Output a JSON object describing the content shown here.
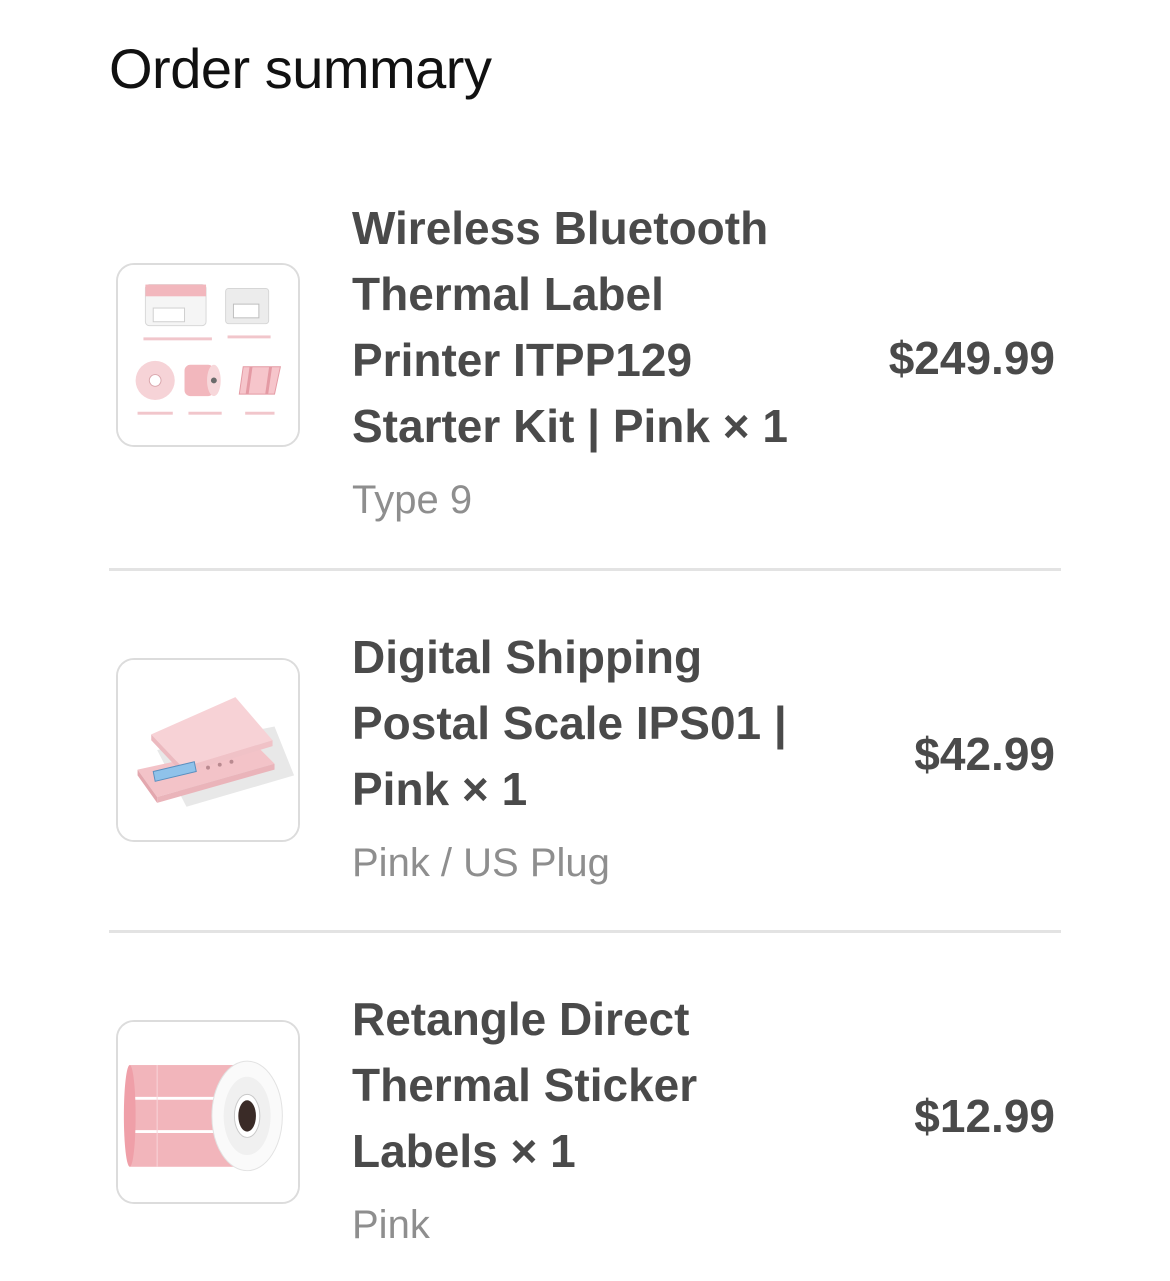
{
  "order_summary": {
    "title": "Order summary",
    "items": [
      {
        "name": "Wireless Bluetooth Thermal Label Printer ITPP129 Starter Kit | Pink × 1",
        "variant": "Type 9",
        "price": "$249.99",
        "image_icon": "thermal-printer-kit-image"
      },
      {
        "name": "Digital Shipping Postal Scale IPS01 | Pink × 1",
        "variant": "Pink / US Plug",
        "price": "$42.99",
        "image_icon": "postal-scale-image"
      },
      {
        "name": "Retangle Direct Thermal Sticker Labels × 1",
        "variant": "Pink",
        "price": "$12.99",
        "image_icon": "label-roll-image"
      }
    ]
  },
  "colors": {
    "product_pink": "#f2b7bd",
    "divider": "#e3e3e3",
    "name_text": "#4a4a4a",
    "variant_text": "#8e8e8e"
  }
}
